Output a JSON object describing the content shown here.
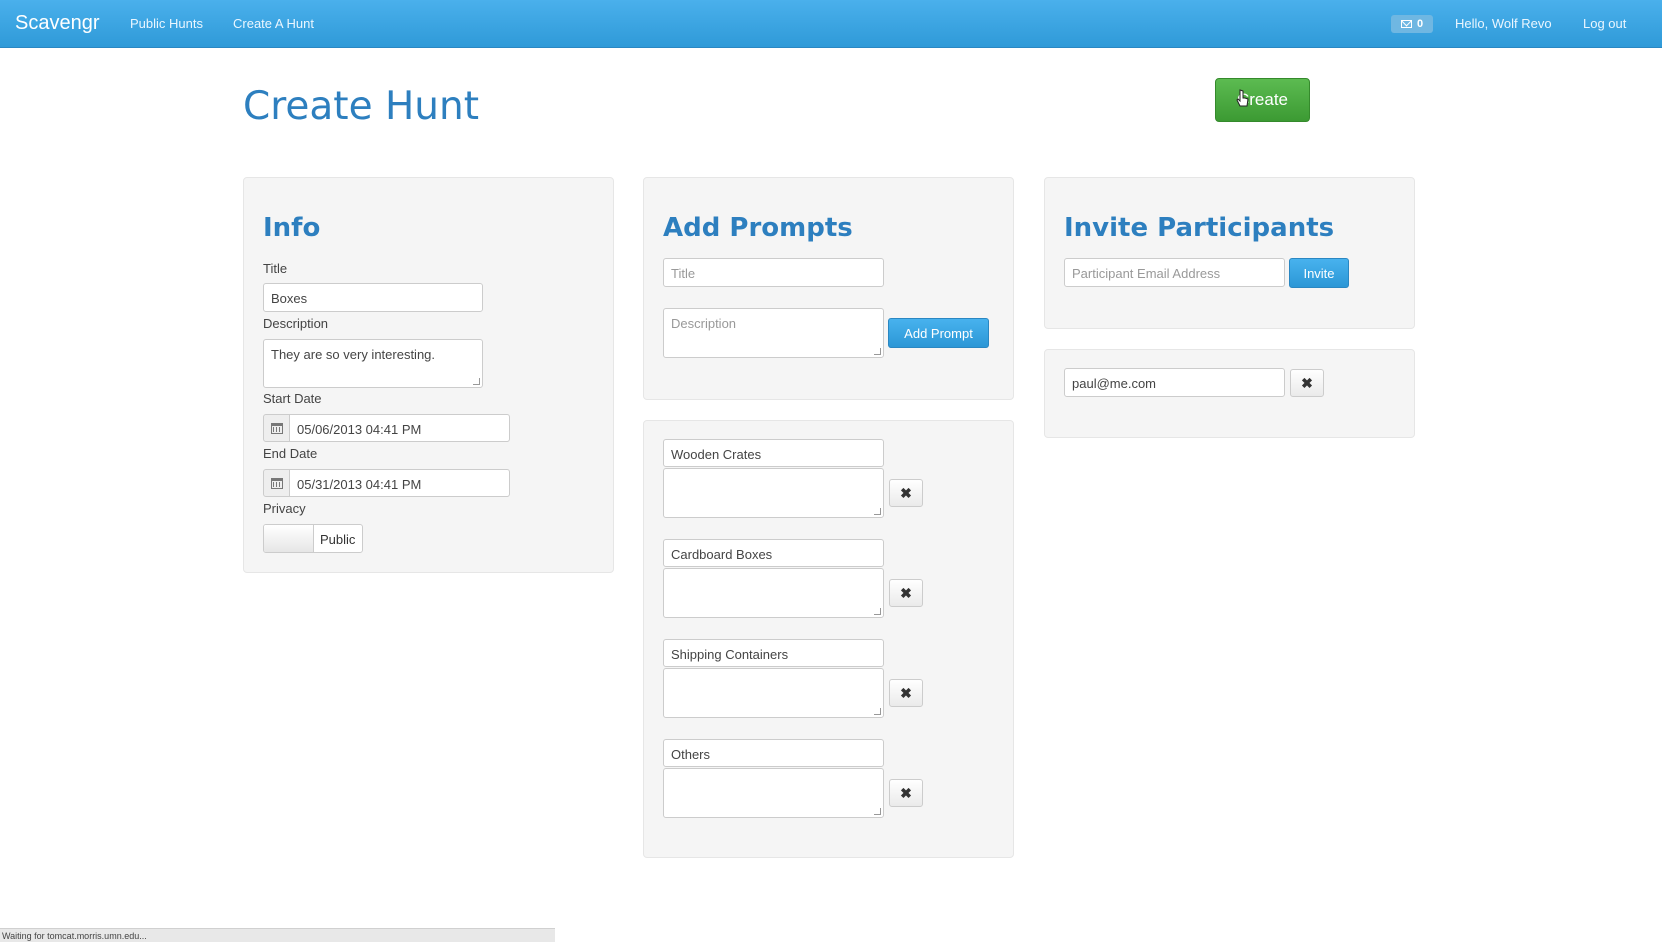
{
  "navbar": {
    "brand": "Scavengr",
    "links": [
      "Public Hunts",
      "Create A Hunt"
    ],
    "messages_count": "0",
    "greeting": "Hello, Wolf Revo",
    "logout": "Log out"
  },
  "page": {
    "title": "Create Hunt",
    "create_button": "Create"
  },
  "info": {
    "heading": "Info",
    "title_label": "Title",
    "title_value": "Boxes",
    "description_label": "Description",
    "description_value": "They are so very interesting.",
    "start_label": "Start Date",
    "start_value": "05/06/2013 04:41 PM",
    "end_label": "End Date",
    "end_value": "05/31/2013 04:41 PM",
    "privacy_label": "Privacy",
    "privacy_value": "Public"
  },
  "prompts": {
    "heading": "Add Prompts",
    "title_placeholder": "Title",
    "description_placeholder": "Description",
    "add_button": "Add Prompt",
    "items": [
      {
        "title": "Wooden Crates",
        "description": ""
      },
      {
        "title": "Cardboard Boxes",
        "description": ""
      },
      {
        "title": "Shipping Containers",
        "description": ""
      },
      {
        "title": "Others",
        "description": ""
      }
    ]
  },
  "participants": {
    "heading": "Invite Participants",
    "email_placeholder": "Participant Email Address",
    "invite_button": "Invite",
    "invited": [
      "paul@me.com"
    ]
  },
  "icons": {
    "remove": "✖",
    "remove_icon_name": "remove-icon",
    "calendar_icon_name": "calendar-icon",
    "envelope_icon_name": "envelope-icon"
  },
  "colors": {
    "navbar": "#3aa3e3",
    "heading": "#2d7fbf",
    "create_button": "#4cae41"
  },
  "status_bar": "Waiting for tomcat.morris.umn.edu..."
}
